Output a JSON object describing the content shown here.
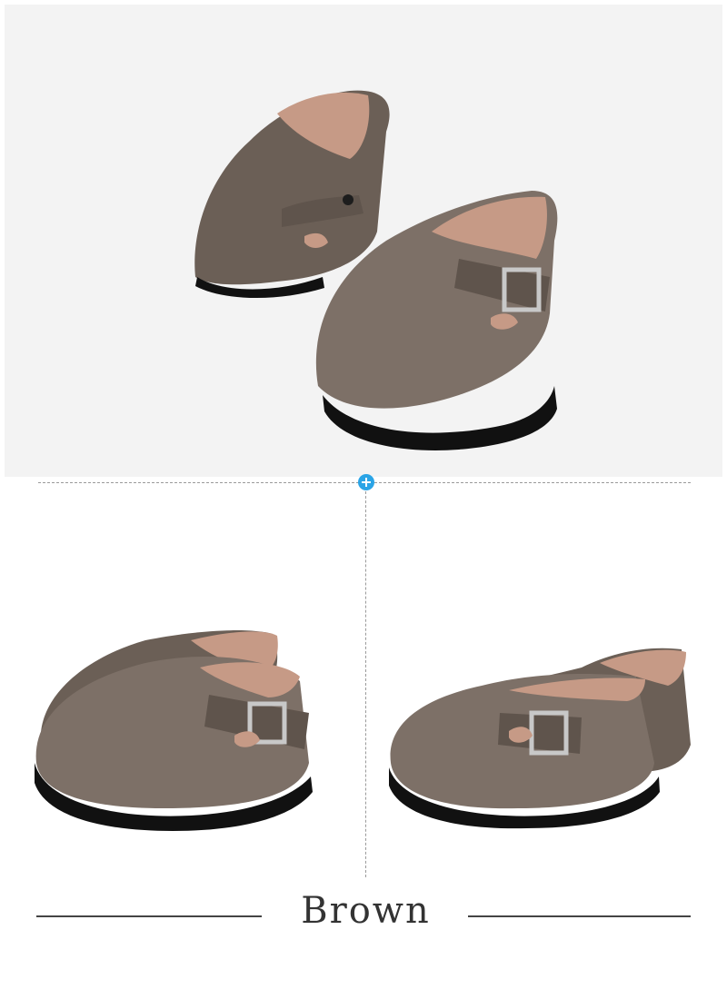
{
  "color_label": "Brown",
  "colors": {
    "shoe_upper": "#6b5f56",
    "shoe_upper_light": "#7d7067",
    "lining": "#c69a86",
    "sole": "#111111",
    "buckle": "#c8c8c8",
    "accent": "#2aa4e6",
    "rule": "#444444"
  },
  "icons": [
    "plus-icon"
  ]
}
